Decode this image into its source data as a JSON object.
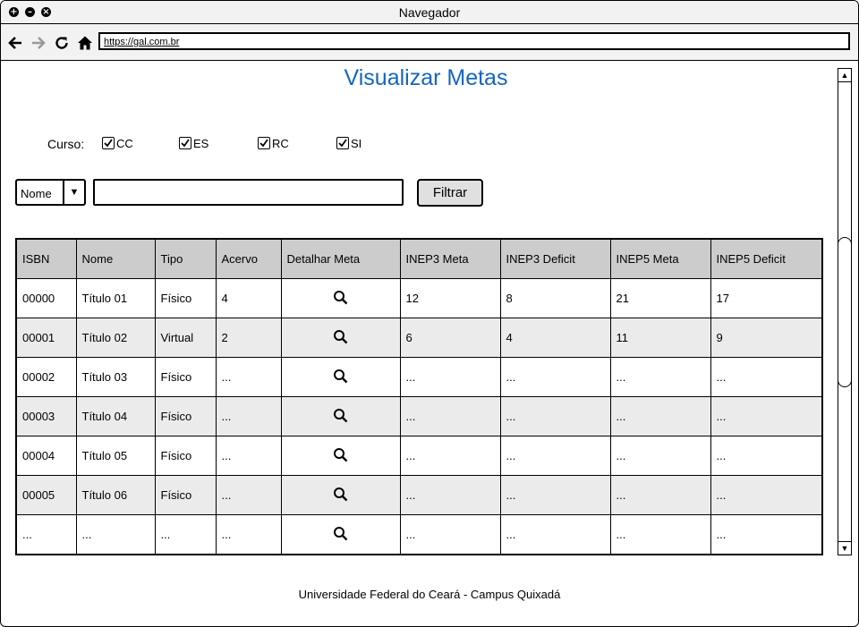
{
  "window": {
    "title": "Navegador"
  },
  "browser": {
    "url": "https://gal.com.br"
  },
  "page": {
    "title": "Visualizar Metas"
  },
  "filters": {
    "curso_label": "Curso:",
    "courses": [
      {
        "label": "CC",
        "checked": true
      },
      {
        "label": "ES",
        "checked": true
      },
      {
        "label": "RC",
        "checked": true
      },
      {
        "label": "SI",
        "checked": true
      }
    ],
    "select_value": "Nome",
    "search_value": "",
    "button_label": "Filtrar"
  },
  "table": {
    "headers": [
      "ISBN",
      "Nome",
      "Tipo",
      "Acervo",
      "Detalhar Meta",
      "INEP3 Meta",
      "INEP3 Deficit",
      "INEP5 Meta",
      "INEP5 Deficit"
    ],
    "rows": [
      {
        "isbn": "00000",
        "nome": "Título 01",
        "tipo": "Físico",
        "acervo": "4",
        "inep3_meta": "12",
        "inep3_deficit": "8",
        "inep5_meta": "21",
        "inep5_deficit": "17"
      },
      {
        "isbn": "00001",
        "nome": "Título 02",
        "tipo": "Virtual",
        "acervo": "2",
        "inep3_meta": "6",
        "inep3_deficit": "4",
        "inep5_meta": "11",
        "inep5_deficit": "9"
      },
      {
        "isbn": "00002",
        "nome": "Título 03",
        "tipo": "Físico",
        "acervo": "...",
        "inep3_meta": "...",
        "inep3_deficit": "...",
        "inep5_meta": "...",
        "inep5_deficit": "..."
      },
      {
        "isbn": "00003",
        "nome": "Título 04",
        "tipo": "Físico",
        "acervo": "...",
        "inep3_meta": "...",
        "inep3_deficit": "...",
        "inep5_meta": "...",
        "inep5_deficit": "..."
      },
      {
        "isbn": "00004",
        "nome": "Título 05",
        "tipo": "Físico",
        "acervo": "...",
        "inep3_meta": "...",
        "inep3_deficit": "...",
        "inep5_meta": "...",
        "inep5_deficit": "..."
      },
      {
        "isbn": "00005",
        "nome": "Título 06",
        "tipo": "Físico",
        "acervo": "...",
        "inep3_meta": "...",
        "inep3_deficit": "...",
        "inep5_meta": "...",
        "inep5_deficit": "..."
      },
      {
        "isbn": "...",
        "nome": "...",
        "tipo": "...",
        "acervo": "...",
        "inep3_meta": "...",
        "inep3_deficit": "...",
        "inep5_meta": "...",
        "inep5_deficit": "..."
      }
    ]
  },
  "footer": {
    "text": "Universidade Federal do Ceará - Campus Quixadá"
  },
  "colors": {
    "title": "#1565c0",
    "header_bg": "#cccccc",
    "alt_row_bg": "#ebebeb"
  }
}
